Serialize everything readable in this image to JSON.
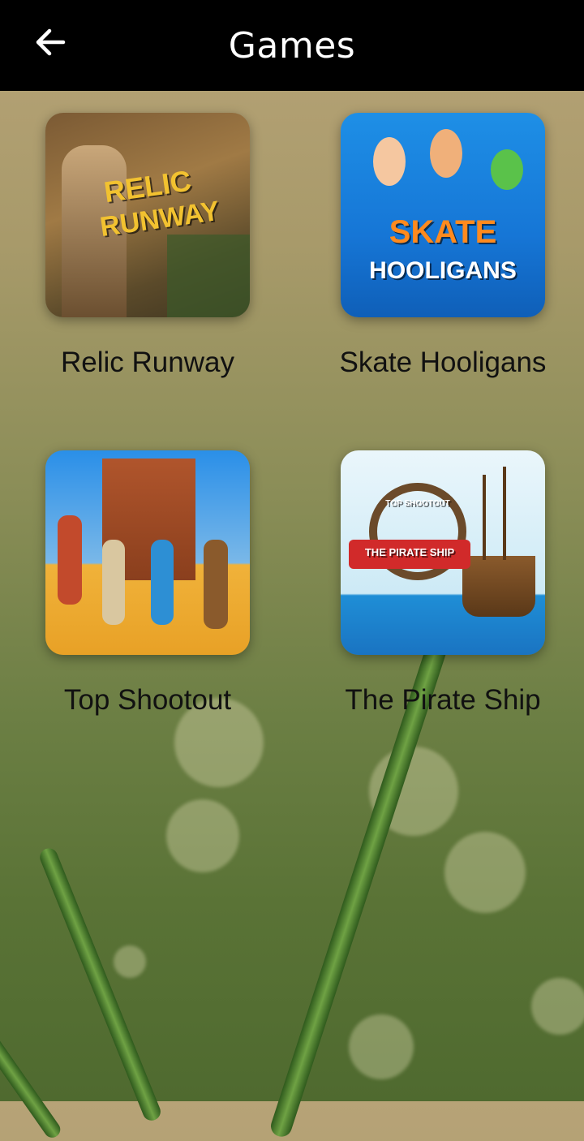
{
  "header": {
    "title": "Games",
    "back_icon": "arrow-left-icon"
  },
  "games": [
    {
      "label": "Relic Runway",
      "art_line1": "RELIC",
      "art_line2": "RUNWAY"
    },
    {
      "label": "Skate Hooligans",
      "art_line1": "SKATE",
      "art_line2": "HOOLIGANS"
    },
    {
      "label": "Top Shootout"
    },
    {
      "label": "The Pirate Ship",
      "art_banner": "THE PIRATE SHIP",
      "art_top": "TOP SHOOTOUT"
    }
  ],
  "colors": {
    "appbar": "#000000",
    "title": "#ffffff",
    "label": "#111111"
  }
}
